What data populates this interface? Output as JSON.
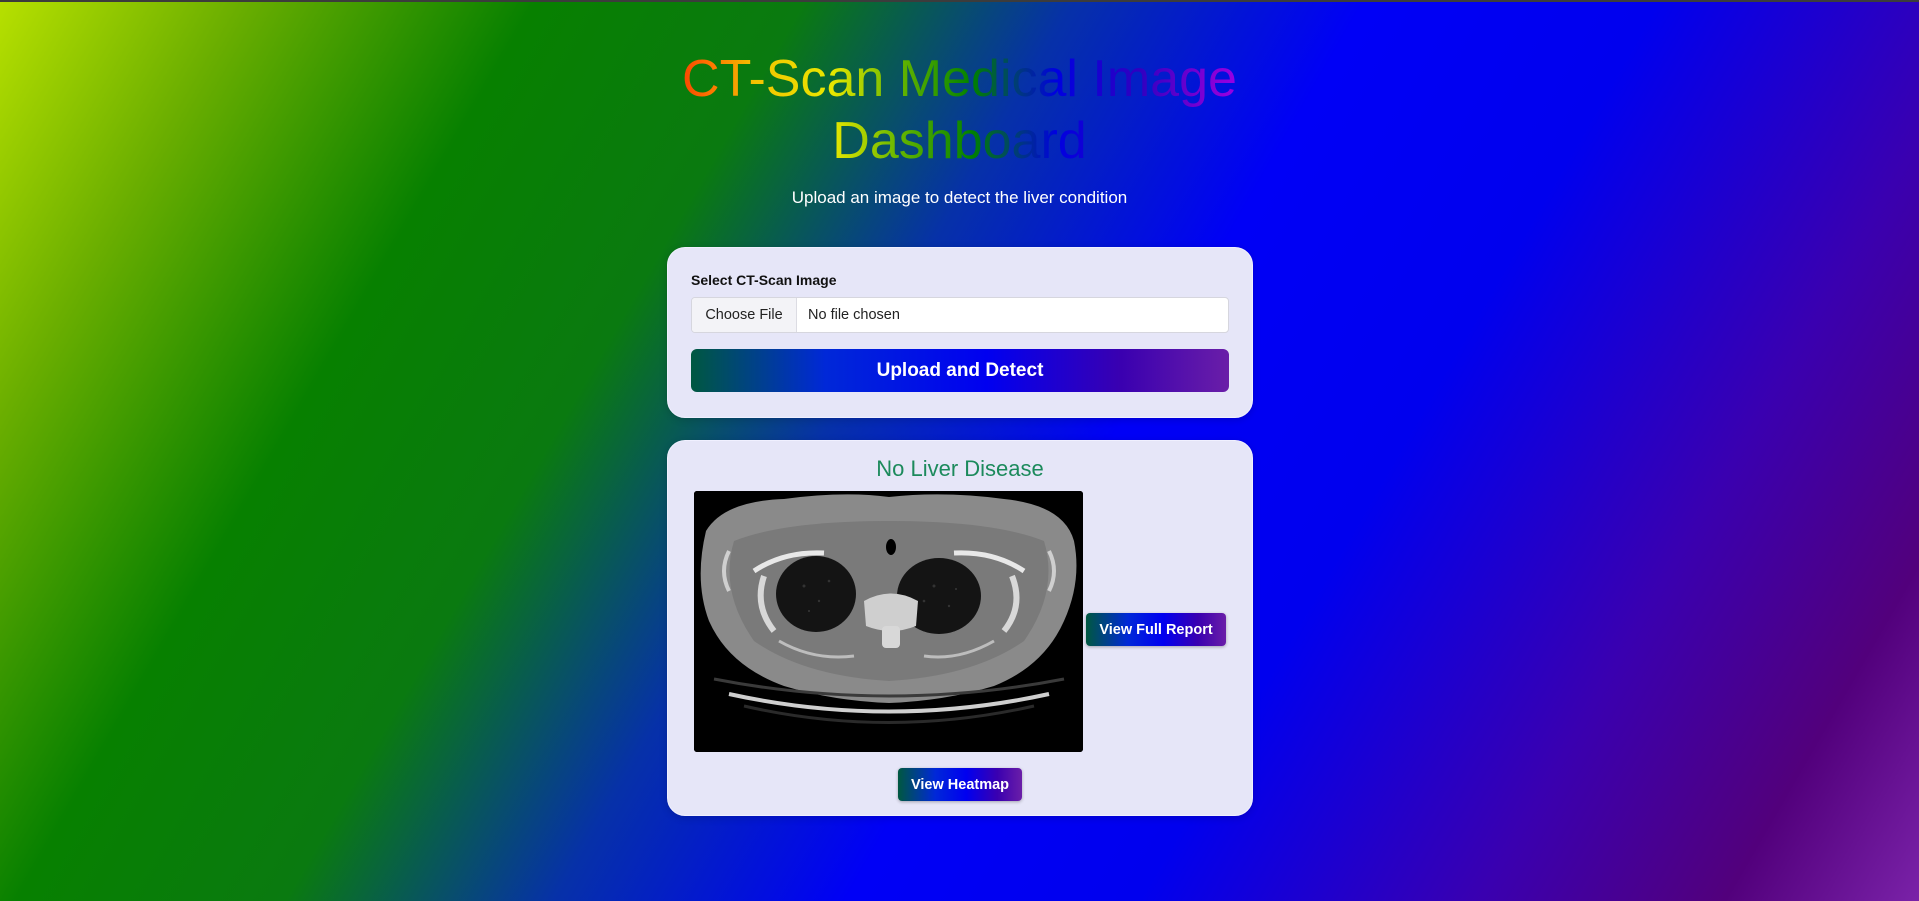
{
  "header": {
    "title": "CT-Scan Medical Image Dashboard",
    "subtitle": "Upload an image to detect the liver condition"
  },
  "upload_form": {
    "label": "Select CT-Scan Image",
    "choose_file_label": "Choose File",
    "file_status": "No file chosen",
    "submit_label": "Upload and Detect"
  },
  "result": {
    "diagnosis": "No Liver Disease",
    "view_report_label": "View Full Report",
    "view_heatmap_label": "View Heatmap"
  },
  "colors": {
    "diagnosis_text": "#1c8a5c",
    "card_background": "#e6e6f8",
    "button_gradient_start": "#005840",
    "button_gradient_end": "#6a1ea8"
  }
}
